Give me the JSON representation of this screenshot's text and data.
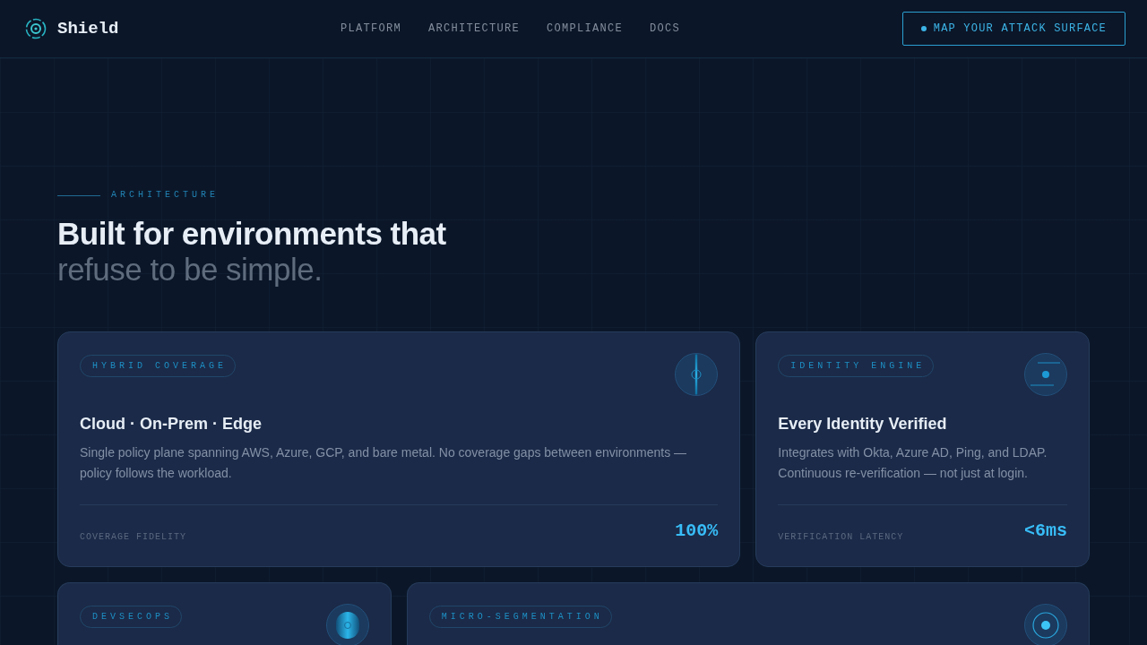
{
  "header": {
    "brand": "Shield",
    "nav": [
      "PLATFORM",
      "ARCHITECTURE",
      "COMPLIANCE",
      "DOCS"
    ],
    "cta": "MAP YOUR ATTACK SURFACE"
  },
  "hero": {
    "eyebrow": "ARCHITECTURE",
    "title": "Built for environments that",
    "subtitle": "refuse to be simple."
  },
  "cards": [
    {
      "tag": "HYBRID COVERAGE",
      "title": "Cloud · On-Prem · Edge",
      "description": "Single policy plane spanning AWS, Azure, GCP, and bare metal. No coverage gaps between environments — policy follows the workload.",
      "metric_label": "COVERAGE FIDELITY",
      "metric_value": "100%"
    },
    {
      "tag": "IDENTITY ENGINE",
      "title": "Every Identity Verified",
      "description": "Integrates with Okta, Azure AD, Ping, and LDAP. Continuous re-verification — not just at login.",
      "metric_label": "VERIFICATION LATENCY",
      "metric_value": "<6ms"
    },
    {
      "tag": "DEVSECOPS"
    },
    {
      "tag": "MICRO-SEGMENTATION"
    }
  ]
}
